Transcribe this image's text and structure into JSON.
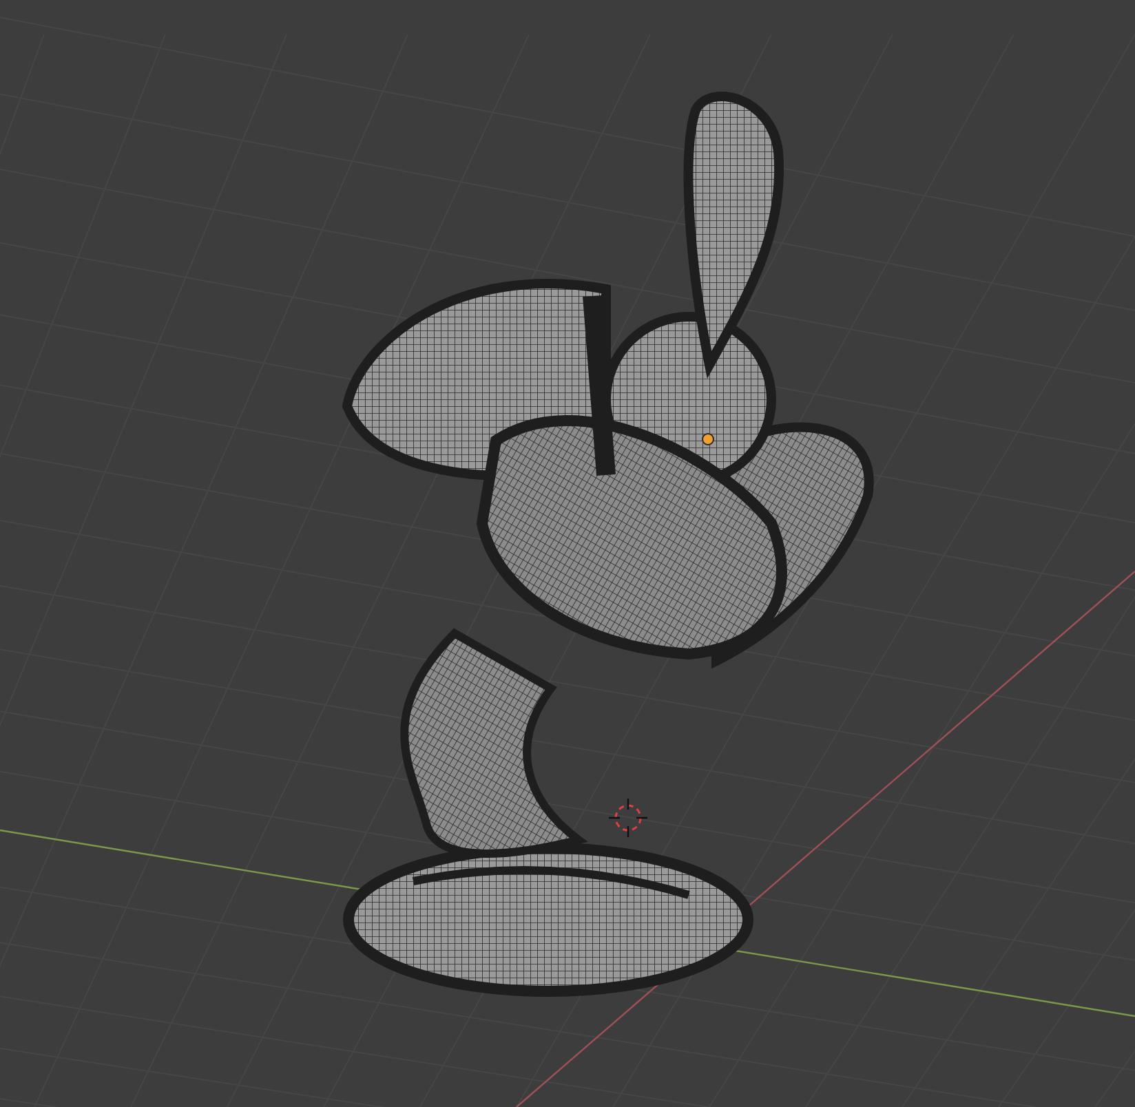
{
  "viewport": {
    "grid_visible": true,
    "cursor_visible": true,
    "origin_visible": true
  }
}
